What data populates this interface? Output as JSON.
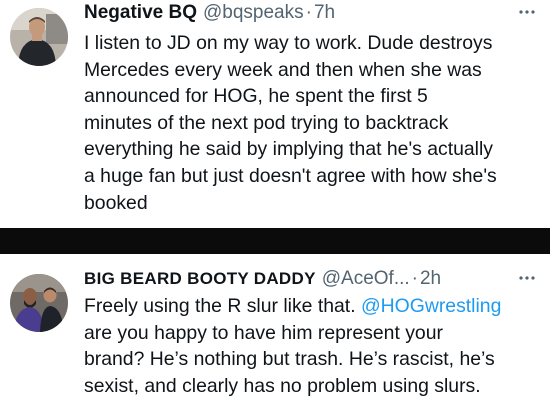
{
  "tweets": [
    {
      "avatar_icon": "avatar-photo",
      "display_name": "Negative BQ",
      "handle": "@bqspeaks",
      "separator": "·",
      "time": "7h",
      "more_icon": "more-options-icon",
      "lines": [
        "I listen to JD on my way to work.  Dude destroys",
        "Mercedes every week and then when she was",
        "announced for HOG, he spent the first 5",
        "minutes of the next pod trying to backtrack",
        "everything he said by implying that he's actually",
        "a huge fan but just doesn't agree with how she's",
        "booked"
      ]
    },
    {
      "avatar_icon": "avatar-photo",
      "display_name": "BIG BEARD BOOTY DADDY",
      "handle": "@AceOf...",
      "separator": "·",
      "time": "2h",
      "more_icon": "more-options-icon",
      "lines": [
        {
          "before": "Freely using the R slur like that. ",
          "mention": "@HOGwrestling"
        },
        "are you happy to have him represent your",
        "brand? He’s nothing but trash. He’s rascist, he’s",
        "sexist, and clearly has no problem using slurs."
      ]
    }
  ],
  "colors": {
    "text": "#0f1419",
    "secondary": "#536471",
    "mention": "#1d9bf0",
    "divider": "#0b0b0b"
  }
}
